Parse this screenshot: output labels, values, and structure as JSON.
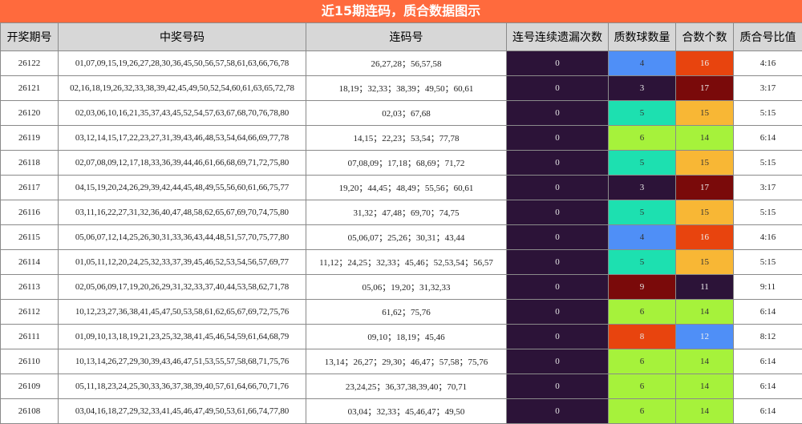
{
  "title": "近15期连码，质合数据图示",
  "headers": [
    "开奖期号",
    "中奖号码",
    "连码号",
    "连号连续遗漏次数",
    "质数球数量",
    "合数个数",
    "质合号比值"
  ],
  "colors": {
    "miss_bg": "#2c1338",
    "prime_3": "#2c1338",
    "prime_4": "#4f8ff7",
    "prime_5": "#1de0b0",
    "prime_6": "#a6f23b",
    "prime_8": "#e8440e",
    "prime_9": "#7a0a0a",
    "comp_11": "#2c1338",
    "comp_12": "#4f8ff7",
    "comp_14": "#a6f23b",
    "comp_15": "#f8b735",
    "comp_16": "#e8440e",
    "comp_17": "#7a0a0a"
  },
  "rows": [
    {
      "issue": "26122",
      "numbers": "01,07,09,15,19,26,27,28,30,36,45,50,56,57,58,61,63,66,76,78",
      "consecutive": "26,27,28；56,57,58",
      "miss": "0",
      "prime": "4",
      "composite": "16",
      "ratio": "4:16"
    },
    {
      "issue": "26121",
      "numbers": "02,16,18,19,26,32,33,38,39,42,45,49,50,52,54,60,61,63,65,72,78",
      "consecutive": "18,19；32,33；38,39；49,50；60,61",
      "miss": "0",
      "prime": "3",
      "composite": "17",
      "ratio": "3:17"
    },
    {
      "issue": "26120",
      "numbers": "02,03,06,10,16,21,35,37,43,45,52,54,57,63,67,68,70,76,78,80",
      "consecutive": "02,03；67,68",
      "miss": "0",
      "prime": "5",
      "composite": "15",
      "ratio": "5:15"
    },
    {
      "issue": "26119",
      "numbers": "03,12,14,15,17,22,23,27,31,39,43,46,48,53,54,64,66,69,77,78",
      "consecutive": "14,15；22,23；53,54；77,78",
      "miss": "0",
      "prime": "6",
      "composite": "14",
      "ratio": "6:14"
    },
    {
      "issue": "26118",
      "numbers": "02,07,08,09,12,17,18,33,36,39,44,46,61,66,68,69,71,72,75,80",
      "consecutive": "07,08,09；17,18；68,69；71,72",
      "miss": "0",
      "prime": "5",
      "composite": "15",
      "ratio": "5:15"
    },
    {
      "issue": "26117",
      "numbers": "04,15,19,20,24,26,29,39,42,44,45,48,49,55,56,60,61,66,75,77",
      "consecutive": "19,20；44,45；48,49；55,56；60,61",
      "miss": "0",
      "prime": "3",
      "composite": "17",
      "ratio": "3:17"
    },
    {
      "issue": "26116",
      "numbers": "03,11,16,22,27,31,32,36,40,47,48,58,62,65,67,69,70,74,75,80",
      "consecutive": "31,32；47,48；69,70；74,75",
      "miss": "0",
      "prime": "5",
      "composite": "15",
      "ratio": "5:15"
    },
    {
      "issue": "26115",
      "numbers": "05,06,07,12,14,25,26,30,31,33,36,43,44,48,51,57,70,75,77,80",
      "consecutive": "05,06,07；25,26；30,31；43,44",
      "miss": "0",
      "prime": "4",
      "composite": "16",
      "ratio": "4:16"
    },
    {
      "issue": "26114",
      "numbers": "01,05,11,12,20,24,25,32,33,37,39,45,46,52,53,54,56,57,69,77",
      "consecutive": "11,12；24,25；32,33；45,46；52,53,54；56,57",
      "miss": "0",
      "prime": "5",
      "composite": "15",
      "ratio": "5:15"
    },
    {
      "issue": "26113",
      "numbers": "02,05,06,09,17,19,20,26,29,31,32,33,37,40,44,53,58,62,71,78",
      "consecutive": "05,06；19,20；31,32,33",
      "miss": "0",
      "prime": "9",
      "composite": "11",
      "ratio": "9:11"
    },
    {
      "issue": "26112",
      "numbers": "10,12,23,27,36,38,41,45,47,50,53,58,61,62,65,67,69,72,75,76",
      "consecutive": "61,62；75,76",
      "miss": "0",
      "prime": "6",
      "composite": "14",
      "ratio": "6:14"
    },
    {
      "issue": "26111",
      "numbers": "01,09,10,13,18,19,21,23,25,32,38,41,45,46,54,59,61,64,68,79",
      "consecutive": "09,10；18,19；45,46",
      "miss": "0",
      "prime": "8",
      "composite": "12",
      "ratio": "8:12"
    },
    {
      "issue": "26110",
      "numbers": "10,13,14,26,27,29,30,39,43,46,47,51,53,55,57,58,68,71,75,76",
      "consecutive": "13,14；26,27；29,30；46,47；57,58；75,76",
      "miss": "0",
      "prime": "6",
      "composite": "14",
      "ratio": "6:14"
    },
    {
      "issue": "26109",
      "numbers": "05,11,18,23,24,25,30,33,36,37,38,39,40,57,61,64,66,70,71,76",
      "consecutive": "23,24,25；36,37,38,39,40；70,71",
      "miss": "0",
      "prime": "6",
      "composite": "14",
      "ratio": "6:14"
    },
    {
      "issue": "26108",
      "numbers": "03,04,16,18,27,29,32,33,41,45,46,47,49,50,53,61,66,74,77,80",
      "consecutive": "03,04；32,33；45,46,47；49,50",
      "miss": "0",
      "prime": "6",
      "composite": "14",
      "ratio": "6:14"
    }
  ]
}
